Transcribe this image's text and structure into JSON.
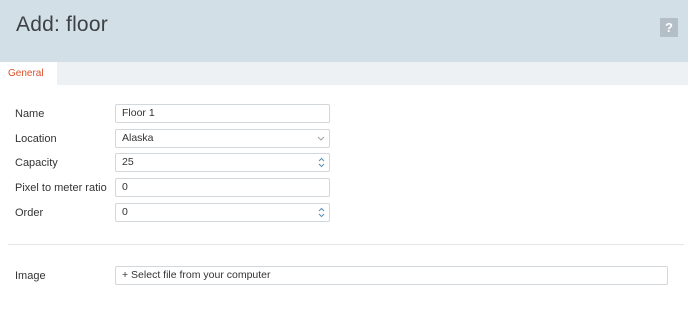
{
  "header": {
    "title": "Add: floor",
    "help_label": "?"
  },
  "tabs": [
    {
      "label": "General"
    }
  ],
  "form": {
    "name": {
      "label": "Name",
      "value": "Floor 1"
    },
    "location": {
      "label": "Location",
      "value": "Alaska"
    },
    "capacity": {
      "label": "Capacity",
      "value": "25"
    },
    "pixel_ratio": {
      "label": "Pixel to meter ratio",
      "value": "0"
    },
    "order": {
      "label": "Order",
      "value": "0"
    },
    "image": {
      "label": "Image",
      "button_label": "+ Select file from your computer"
    }
  },
  "colors": {
    "header_bg": "#d3dfe7",
    "tab_active_text": "#d9502b",
    "tabbar_bg": "#eef1f3"
  }
}
